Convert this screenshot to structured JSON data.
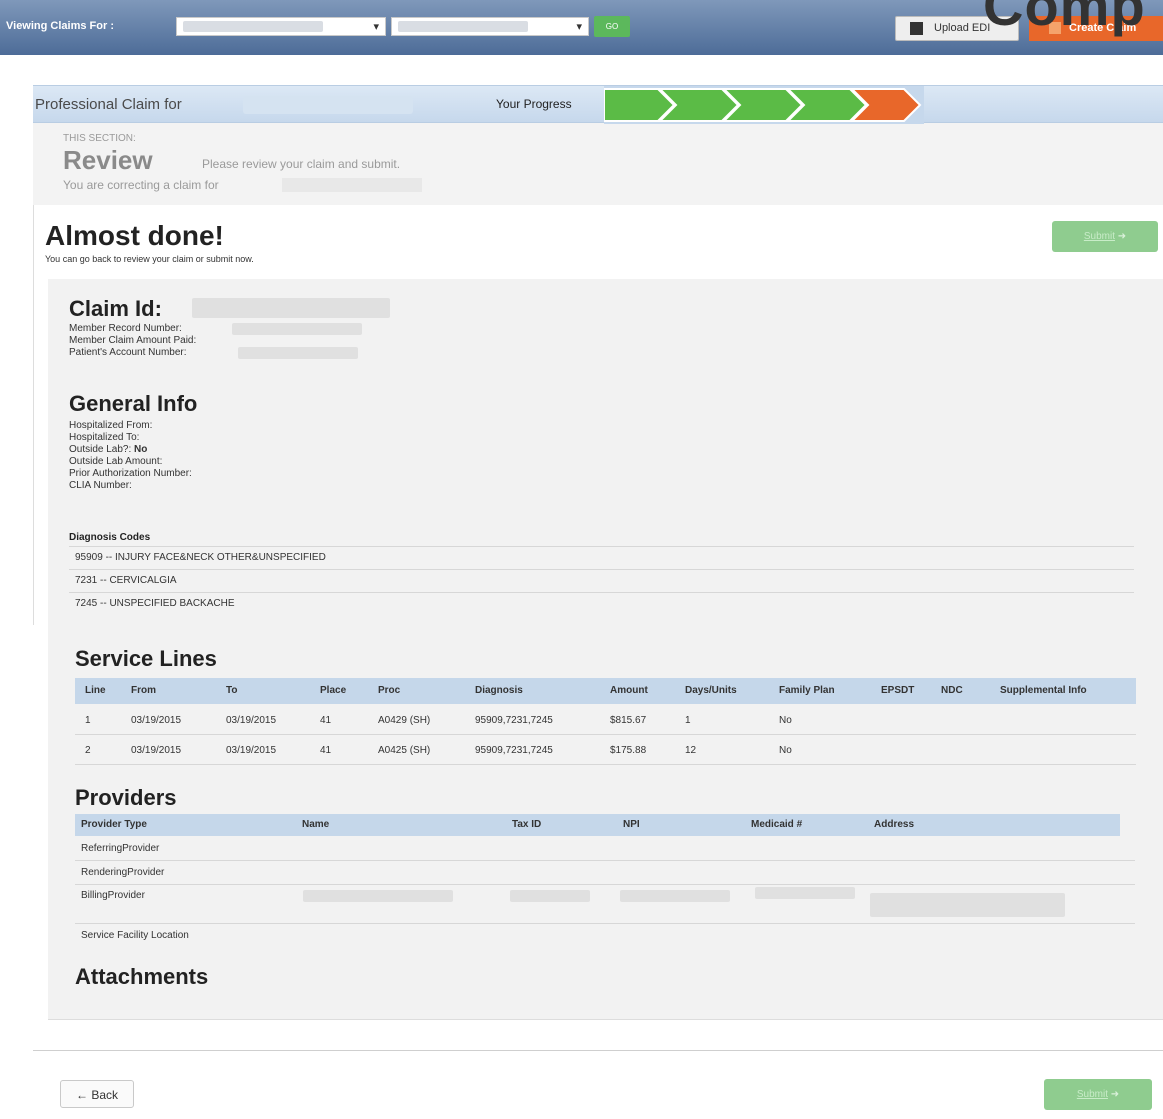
{
  "topbar": {
    "viewing_label": "Viewing Claims For :",
    "go_label": "GO",
    "upload_label": "Upload EDI",
    "create_label": "Create Claim",
    "partial_heading": "Comp"
  },
  "claim_header": {
    "title": "Professional Claim for",
    "progress_label": "Your Progress"
  },
  "section": {
    "eyebrow": "THIS SECTION:",
    "name": "Review",
    "hint": "Please review your claim and submit.",
    "correcting": "You are correcting a claim for"
  },
  "main": {
    "heading": "Almost done!",
    "subheading": "You can go back to review your claim or submit now.",
    "submit_label": "Submit"
  },
  "claim": {
    "id_label": "Claim Id:",
    "member_record": "Member Record Number:",
    "amount_paid": "Member Claim Amount Paid:",
    "patient_account": "Patient's Account Number:"
  },
  "general": {
    "title": "General Info",
    "hosp_from": "Hospitalized From:",
    "hosp_to": "Hospitalized To:",
    "outside_lab_label": "Outside Lab?:",
    "outside_lab_value": "No",
    "outside_lab_amount": "Outside Lab Amount:",
    "prior_auth": "Prior Authorization Number:",
    "clia": "CLIA Number:"
  },
  "diagnosis": {
    "title": "Diagnosis Codes",
    "rows": [
      "95909 -- INJURY FACE&NECK OTHER&UNSPECIFIED",
      "7231 -- CERVICALGIA",
      "7245 -- UNSPECIFIED BACKACHE"
    ]
  },
  "service_lines": {
    "title": "Service Lines",
    "headers": [
      "Line",
      "From",
      "To",
      "Place",
      "Proc",
      "Diagnosis",
      "Amount",
      "Days/Units",
      "Family Plan",
      "EPSDT",
      "NDC",
      "Supplemental Info"
    ],
    "rows": [
      [
        "1",
        "03/19/2015",
        "03/19/2015",
        "41",
        "A0429 (SH)",
        "95909,7231,7245",
        "$815.67",
        "1",
        "No"
      ],
      [
        "2",
        "03/19/2015",
        "03/19/2015",
        "41",
        "A0425 (SH)",
        "95909,7231,7245",
        "$175.88",
        "12",
        "No"
      ]
    ]
  },
  "providers": {
    "title": "Providers",
    "headers": [
      "Provider Type",
      "Name",
      "Tax ID",
      "NPI",
      "Medicaid #",
      "Address"
    ],
    "rows": [
      "ReferringProvider",
      "RenderingProvider",
      "BillingProvider",
      "Service Facility Location"
    ]
  },
  "attachments": {
    "title": "Attachments"
  },
  "footer": {
    "back_label": "Back",
    "submit_label": "Submit"
  },
  "colors": {
    "accent": "#5cb85c",
    "create": "#e8672a",
    "progress_done": "#5bbb46",
    "progress_current": "#e8672a",
    "table_header": "#c5d7ea"
  }
}
